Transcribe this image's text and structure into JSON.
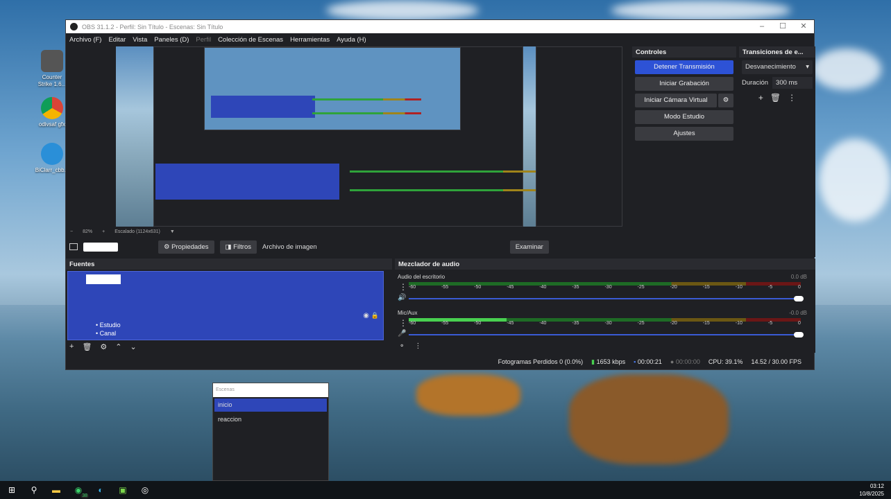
{
  "desktop": {
    "icons": [
      {
        "label": "Counter Strike 1.6..."
      },
      {
        "label": "odivsaf gfx"
      },
      {
        "label": "BiClarr_cbb..."
      }
    ]
  },
  "window": {
    "title": "OBS 31.1.2 - Perfil: Sin Título - Escenas: Sin Título",
    "menu": [
      "Archivo (F)",
      "Editar",
      "Vista",
      "Paneles (D)",
      "Perfil",
      "Colección de Escenas",
      "Herramientas",
      "Ayuda (H)"
    ]
  },
  "preview": {
    "zoom": "82%",
    "scaling": "Escalado (1124x631)"
  },
  "scene_toolbar": {
    "properties": "Propiedades",
    "filters": "Filtros",
    "source_type": "Archivo de imagen",
    "browse": "Examinar"
  },
  "controls": {
    "title": "Controles",
    "stop_stream": "Detener Transmisión",
    "start_recording": "Iniciar Grabación",
    "start_virtual_cam": "Iniciar Cámara Virtual",
    "studio_mode": "Modo Estudio",
    "settings": "Ajustes"
  },
  "transitions": {
    "title": "Transiciones de e...",
    "selected": "Desvanecimiento",
    "duration_label": "Duración",
    "duration_value": "300 ms"
  },
  "sources": {
    "title": "Fuentes",
    "list_items": [
      "Estudio",
      "Canal"
    ]
  },
  "mixer": {
    "title": "Mezclador de audio",
    "tracks": [
      {
        "name": "Audio del escritorio",
        "db": "0.0 dB",
        "level": 0
      },
      {
        "name": "Mic/Aux",
        "db": "-0.0 dB",
        "level": 0.25
      }
    ],
    "ticks": [
      "-60",
      "-55",
      "-50",
      "-45",
      "-40",
      "-35",
      "-30",
      "-25",
      "-20",
      "-15",
      "-10",
      "-5",
      "0"
    ]
  },
  "status": {
    "dropped": "Fotogramas Perdidos 0 (0.0%)",
    "bitrate": "1653 kbps",
    "stream_time": "00:00:21",
    "rec_time": "00:00:00",
    "cpu": "CPU: 39.1%",
    "fps": "14.52 / 30.00 FPS"
  },
  "scene_popup": {
    "search_placeholder": "Escenas",
    "items": [
      "inicio",
      "reaccion"
    ]
  },
  "taskbar": {
    "whatsapp_badge": "38",
    "time": "03:12",
    "date": "10/8/2025"
  },
  "colors": {
    "accent": "#2d52d6",
    "selection": "#2e46b8",
    "panel": "#1f2024"
  }
}
